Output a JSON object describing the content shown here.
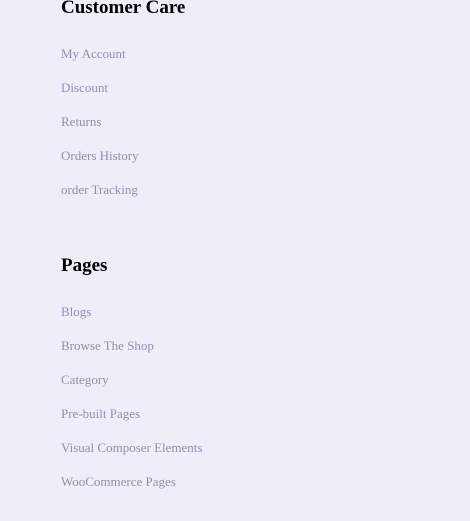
{
  "customer_care": {
    "heading": "Customer Care",
    "links": [
      {
        "label": "My Account"
      },
      {
        "label": "Discount"
      },
      {
        "label": "Returns"
      },
      {
        "label": "Orders History"
      },
      {
        "label": "order Tracking"
      }
    ]
  },
  "pages": {
    "heading": "Pages",
    "links": [
      {
        "label": "Blogs"
      },
      {
        "label": "Browse The Shop"
      },
      {
        "label": "Category"
      },
      {
        "label": "Pre-built Pages"
      },
      {
        "label": "Visual Composer Elements"
      },
      {
        "label": "WooCommerce Pages"
      }
    ]
  },
  "colors": {
    "background": "#eeeef9",
    "heading": "#000000",
    "link": "#8d90b2"
  }
}
